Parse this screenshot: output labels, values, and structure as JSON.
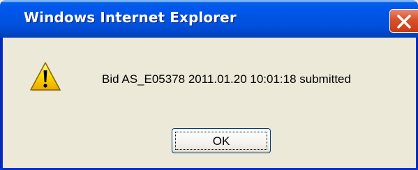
{
  "window": {
    "title": "Windows Internet Explorer",
    "close_icon": "close-icon",
    "accent_color": "#0055e5",
    "close_color": "#d9512b",
    "background_color": "#ece9d8"
  },
  "dialog": {
    "icon": "warning-icon",
    "message": "Bid AS_E05378 2011.01.20 10:01:18 submitted",
    "ok_label": "OK"
  }
}
